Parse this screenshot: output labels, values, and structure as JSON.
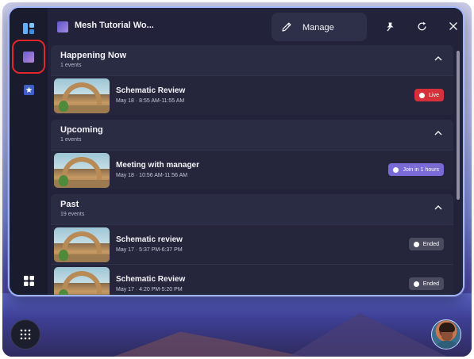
{
  "window": {
    "title": "Mesh Tutorial Wo...",
    "manage_label": "Manage"
  },
  "sections": [
    {
      "title": "Happening Now",
      "count": "1 events",
      "events": [
        {
          "title": "Schematic Review",
          "time": "May 18 · 8:55 AM-11:55 AM",
          "badge": "Live",
          "badge_type": "live"
        }
      ]
    },
    {
      "title": "Upcoming",
      "count": "1 events",
      "events": [
        {
          "title": "Meeting with manager",
          "time": "May 18 · 10:56 AM-11:56 AM",
          "badge": "Join in 1 hours",
          "badge_type": "join"
        }
      ]
    },
    {
      "title": "Past",
      "count": "19 events",
      "events": [
        {
          "title": "Schematic review",
          "time": "May 17 · 5:37 PM-6:37 PM",
          "badge": "Ended",
          "badge_type": "ended"
        },
        {
          "title": "Schematic Review",
          "time": "May 17 · 4:20 PM-5:20 PM",
          "badge": "Ended",
          "badge_type": "ended"
        }
      ]
    }
  ],
  "colors": {
    "live": "#d6303b",
    "join": "#7a6ad8",
    "ended": "#4a4b5e",
    "highlight_ring": "#e3262b",
    "panel_border": "#9fb4ff"
  },
  "icons": {
    "rail_top": "layout-icon",
    "rail_selected": "world-thumbnail-icon",
    "rail_star": "star-icon",
    "rail_bottom": "apps-grid-icon",
    "manage": "pencil-icon",
    "pin": "pin-icon",
    "refresh": "refresh-icon",
    "close": "close-icon",
    "launcher": "dots-grid-icon"
  }
}
